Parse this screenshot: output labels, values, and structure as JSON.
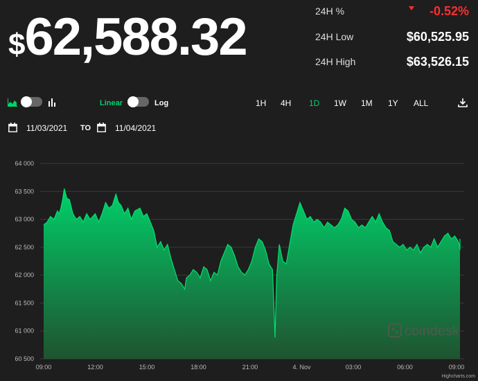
{
  "price": {
    "currency": "$",
    "value": "62,588.32"
  },
  "stats": {
    "change": {
      "label": "24H %",
      "value": "-0.52%"
    },
    "low": {
      "label": "24H Low",
      "value": "$60,525.95"
    },
    "high": {
      "label": "24H High",
      "value": "$63,526.15"
    }
  },
  "controls": {
    "chart_type_left_icon": "area-chart-icon",
    "chart_type_right_icon": "bar-chart-icon",
    "scale_linear_label": "Linear",
    "scale_log_label": "Log",
    "ranges": [
      "1H",
      "4H",
      "1D",
      "1W",
      "1M",
      "1Y",
      "ALL"
    ],
    "active_range": "1D",
    "download_icon": "download-icon"
  },
  "dates": {
    "from": "11/03/2021",
    "to_label": "TO",
    "to": "11/04/2021",
    "icon": "calendar-icon"
  },
  "colors": {
    "accent": "#00d26a",
    "negative": "#ff2e2e",
    "background": "#1e1e1e"
  },
  "watermark": "coindesk",
  "credit": "Highcharts.com",
  "chart_data": {
    "type": "area",
    "x_ticks": [
      "09:00",
      "12:00",
      "15:00",
      "18:00",
      "21:00",
      "4. Nov",
      "03:00",
      "06:00",
      "09:00"
    ],
    "x_unit": "hours since 09:00 on 11/03/2021",
    "ylim": [
      60500,
      64000
    ],
    "y_ticks": [
      "64 000",
      "63 500",
      "63 000",
      "62 500",
      "62 000",
      "61 500",
      "61 000",
      "60 500"
    ],
    "y_tick_values": [
      64000,
      63500,
      63000,
      62500,
      62000,
      61500,
      61000,
      60500
    ],
    "grid": true,
    "points": [
      [
        0,
        62900
      ],
      [
        0.2,
        62950
      ],
      [
        0.4,
        63050
      ],
      [
        0.6,
        63000
      ],
      [
        0.8,
        63150
      ],
      [
        0.9,
        63100
      ],
      [
        1.0,
        63200
      ],
      [
        1.1,
        63350
      ],
      [
        1.2,
        63550
      ],
      [
        1.35,
        63380
      ],
      [
        1.5,
        63350
      ],
      [
        1.7,
        63100
      ],
      [
        1.9,
        63000
      ],
      [
        2.1,
        63050
      ],
      [
        2.3,
        62950
      ],
      [
        2.5,
        63100
      ],
      [
        2.7,
        63000
      ],
      [
        3.0,
        63100
      ],
      [
        3.2,
        62950
      ],
      [
        3.4,
        63100
      ],
      [
        3.6,
        63300
      ],
      [
        3.8,
        63200
      ],
      [
        4.0,
        63250
      ],
      [
        4.2,
        63450
      ],
      [
        4.35,
        63300
      ],
      [
        4.5,
        63250
      ],
      [
        4.7,
        63100
      ],
      [
        4.9,
        63200
      ],
      [
        5.1,
        63000
      ],
      [
        5.3,
        63150
      ],
      [
        5.6,
        63200
      ],
      [
        5.8,
        63050
      ],
      [
        6.0,
        63100
      ],
      [
        6.2,
        62950
      ],
      [
        6.4,
        62800
      ],
      [
        6.6,
        62500
      ],
      [
        6.8,
        62600
      ],
      [
        7.0,
        62450
      ],
      [
        7.2,
        62550
      ],
      [
        7.4,
        62300
      ],
      [
        7.6,
        62100
      ],
      [
        7.8,
        61900
      ],
      [
        8.0,
        61850
      ],
      [
        8.2,
        61750
      ],
      [
        8.3,
        61950
      ],
      [
        8.5,
        62000
      ],
      [
        8.7,
        62100
      ],
      [
        8.9,
        62050
      ],
      [
        9.1,
        61950
      ],
      [
        9.3,
        62150
      ],
      [
        9.5,
        62100
      ],
      [
        9.7,
        61900
      ],
      [
        9.9,
        62050
      ],
      [
        10.1,
        62000
      ],
      [
        10.3,
        62250
      ],
      [
        10.5,
        62400
      ],
      [
        10.7,
        62550
      ],
      [
        10.9,
        62500
      ],
      [
        11.1,
        62350
      ],
      [
        11.3,
        62150
      ],
      [
        11.5,
        62050
      ],
      [
        11.7,
        62000
      ],
      [
        11.9,
        62100
      ],
      [
        12.1,
        62250
      ],
      [
        12.3,
        62500
      ],
      [
        12.5,
        62650
      ],
      [
        12.7,
        62600
      ],
      [
        12.9,
        62450
      ],
      [
        13.1,
        62200
      ],
      [
        13.3,
        62100
      ],
      [
        13.4,
        61300
      ],
      [
        13.45,
        60880
      ],
      [
        13.55,
        62000
      ],
      [
        13.7,
        62550
      ],
      [
        13.9,
        62250
      ],
      [
        14.1,
        62200
      ],
      [
        14.3,
        62550
      ],
      [
        14.5,
        62900
      ],
      [
        14.7,
        63100
      ],
      [
        14.9,
        63300
      ],
      [
        15.1,
        63150
      ],
      [
        15.3,
        63000
      ],
      [
        15.5,
        63050
      ],
      [
        15.7,
        62950
      ],
      [
        15.9,
        63000
      ],
      [
        16.1,
        62950
      ],
      [
        16.3,
        62850
      ],
      [
        16.5,
        62950
      ],
      [
        16.7,
        62900
      ],
      [
        16.9,
        62850
      ],
      [
        17.1,
        62900
      ],
      [
        17.3,
        63000
      ],
      [
        17.5,
        63200
      ],
      [
        17.7,
        63150
      ],
      [
        17.9,
        63000
      ],
      [
        18.1,
        62950
      ],
      [
        18.3,
        62850
      ],
      [
        18.5,
        62900
      ],
      [
        18.7,
        62850
      ],
      [
        18.9,
        62950
      ],
      [
        19.1,
        63050
      ],
      [
        19.3,
        62950
      ],
      [
        19.5,
        63100
      ],
      [
        19.7,
        62950
      ],
      [
        19.9,
        62850
      ],
      [
        20.1,
        62800
      ],
      [
        20.3,
        62600
      ],
      [
        20.5,
        62550
      ],
      [
        20.7,
        62500
      ],
      [
        20.9,
        62550
      ],
      [
        21.1,
        62450
      ],
      [
        21.3,
        62500
      ],
      [
        21.5,
        62450
      ],
      [
        21.7,
        62550
      ],
      [
        21.9,
        62400
      ],
      [
        22.1,
        62500
      ],
      [
        22.3,
        62550
      ],
      [
        22.5,
        62500
      ],
      [
        22.7,
        62650
      ],
      [
        22.9,
        62500
      ],
      [
        23.1,
        62600
      ],
      [
        23.3,
        62700
      ],
      [
        23.5,
        62750
      ],
      [
        23.7,
        62650
      ],
      [
        23.9,
        62700
      ],
      [
        24.1,
        62600
      ],
      [
        24.3,
        62500
      ],
      [
        24.5,
        62550
      ],
      [
        24.7,
        62450
      ],
      [
        24.9,
        62500
      ],
      [
        25.1,
        62550
      ],
      [
        25.3,
        62450
      ],
      [
        25.5,
        62600
      ],
      [
        25.75,
        62650
      ]
    ]
  }
}
